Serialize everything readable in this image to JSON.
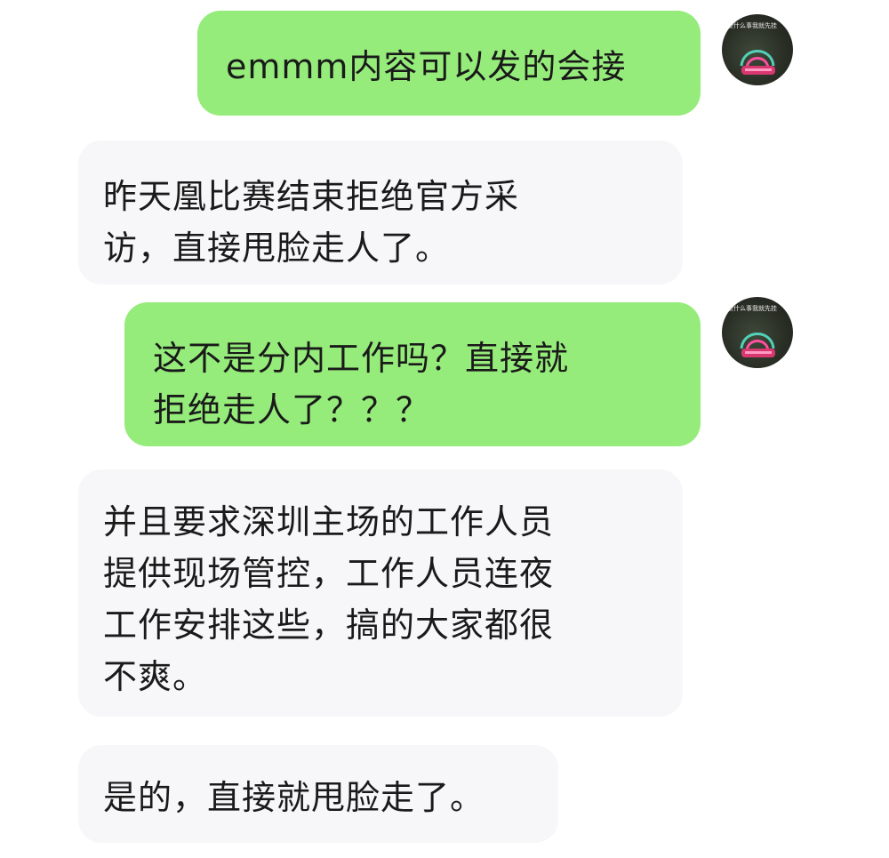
{
  "messages": [
    {
      "id": "msg-1",
      "direction": "outgoing",
      "text": "emmm内容可以发的会接"
    },
    {
      "id": "msg-2",
      "direction": "incoming",
      "text": "昨天凰比赛结束拒绝官方采\n访，直接甩脸走人了。"
    },
    {
      "id": "msg-3",
      "direction": "outgoing",
      "text": "这不是分内工作吗？直接就\n拒绝走人了？？？"
    },
    {
      "id": "msg-4",
      "direction": "incoming",
      "text": "并且要求深圳主场的工作人员\n提供现场管控，工作人员连夜\n工作安排这些，搞的大家都很\n不爽。"
    },
    {
      "id": "msg-5",
      "direction": "incoming",
      "text": "是的，直接就甩脸走了。"
    }
  ],
  "avatar": {
    "caption": "没什么事我就先挂",
    "icon": "neon-sign-avatar"
  },
  "colors": {
    "outgoing_bubble": "#95ec7b",
    "incoming_bubble": "#f7f7f9",
    "background": "#ffffff"
  }
}
